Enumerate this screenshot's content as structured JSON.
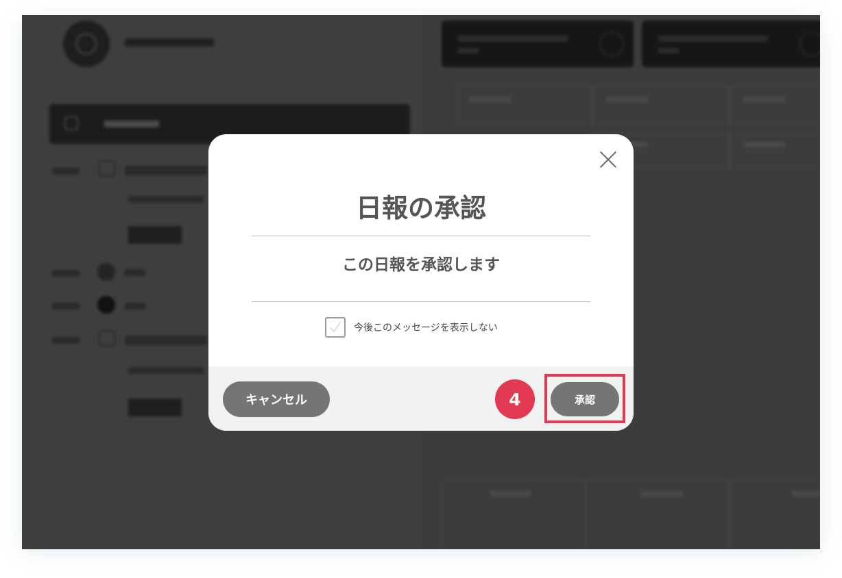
{
  "dialog": {
    "title": "日報の承認",
    "message": "この日報を承認します",
    "dont_show_again_label": "今後このメッセージを表示しない",
    "dont_show_again_checked": false,
    "cancel_label": "キャンセル",
    "approve_label": "承認",
    "step_number": "4"
  },
  "colors": {
    "button_gray": "#757575",
    "highlight_red": "#e23a52",
    "overlay_dark": "#3c3c3c",
    "footer_bg": "#f1f1f1"
  },
  "icons": {
    "close": "close-icon",
    "checkbox": "checkbox-icon"
  }
}
